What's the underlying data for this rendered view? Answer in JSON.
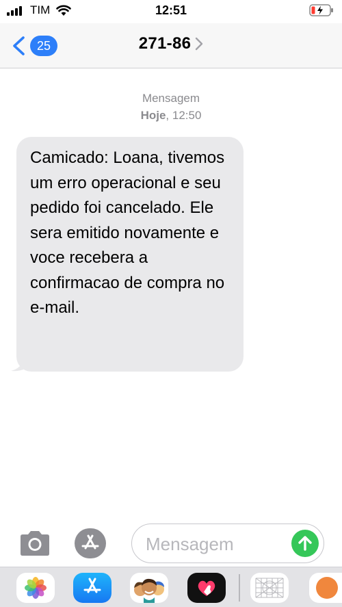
{
  "status_bar": {
    "carrier": "TIM",
    "time": "12:51",
    "battery_color": "#ff3b30"
  },
  "header": {
    "unread_count": "25",
    "contact": "271-86",
    "accent_color": "#2d7ff9"
  },
  "thread": {
    "label": "Mensagem",
    "day": "Hoje",
    "time": ", 12:50",
    "message": "Camicado: Loana, tivemos um erro operacional e seu pedido foi cancelado. Ele sera emitido novamente e voce recebera a confirmacao de compra no e-mail."
  },
  "composer": {
    "placeholder": "Mensagem",
    "send_color": "#35c759"
  },
  "app_drawer": {
    "apps": [
      "photos-icon",
      "app-store-icon",
      "memoji-icon",
      "digital-touch-icon",
      "grid-app-icon",
      "orange-app-icon"
    ]
  }
}
